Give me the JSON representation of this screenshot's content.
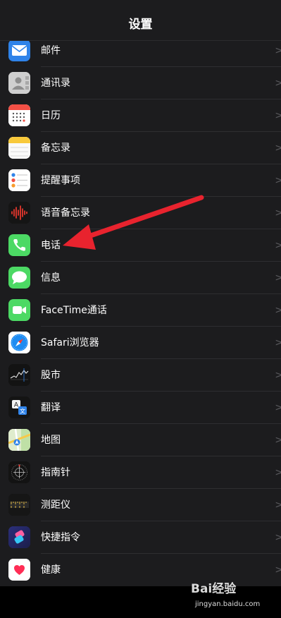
{
  "navbar": {
    "title": "设置"
  },
  "rows": [
    {
      "label": "邮件",
      "icon": "mail-icon"
    },
    {
      "label": "通讯录",
      "icon": "contacts-icon"
    },
    {
      "label": "日历",
      "icon": "calendar-icon"
    },
    {
      "label": "备忘录",
      "icon": "notes-icon"
    },
    {
      "label": "提醒事项",
      "icon": "reminders-icon"
    },
    {
      "label": "语音备忘录",
      "icon": "voice-memos-icon"
    },
    {
      "label": "电话",
      "icon": "phone-icon"
    },
    {
      "label": "信息",
      "icon": "messages-icon"
    },
    {
      "label": "FaceTime通话",
      "icon": "facetime-icon"
    },
    {
      "label": "Safari浏览器",
      "icon": "safari-icon"
    },
    {
      "label": "股市",
      "icon": "stocks-icon"
    },
    {
      "label": "翻译",
      "icon": "translate-icon"
    },
    {
      "label": "地图",
      "icon": "maps-icon"
    },
    {
      "label": "指南针",
      "icon": "compass-icon"
    },
    {
      "label": "测距仪",
      "icon": "measure-icon"
    },
    {
      "label": "快捷指令",
      "icon": "shortcuts-icon"
    },
    {
      "label": "健康",
      "icon": "health-icon"
    }
  ],
  "chevron": ">",
  "watermark": {
    "brand": "Bai经验",
    "sub": "jingyan.baidu.com"
  },
  "colors": {
    "background": "#1c1c1e",
    "separator": "#2e2e31",
    "annotation_arrow": "#e8232e"
  }
}
